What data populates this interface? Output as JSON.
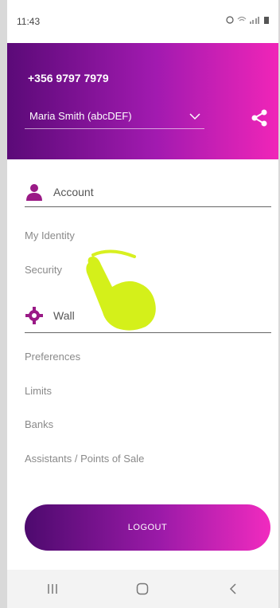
{
  "status": {
    "time": "11:43"
  },
  "header": {
    "phone": "+356 9797 7979",
    "account_name": "Maria Smith (abcDEF)"
  },
  "sections": {
    "account": {
      "title": "Account",
      "items": [
        "My Identity",
        "Security"
      ]
    },
    "wallet": {
      "title": "Wall",
      "items": [
        "Preferences",
        "Limits",
        "Banks",
        "Assistants / Points of Sale"
      ]
    }
  },
  "logout_label": "LOGOUT",
  "colors": {
    "gradient_start": "#5b0a78",
    "gradient_end": "#f025b8",
    "icon_purple": "#9a1a86"
  }
}
